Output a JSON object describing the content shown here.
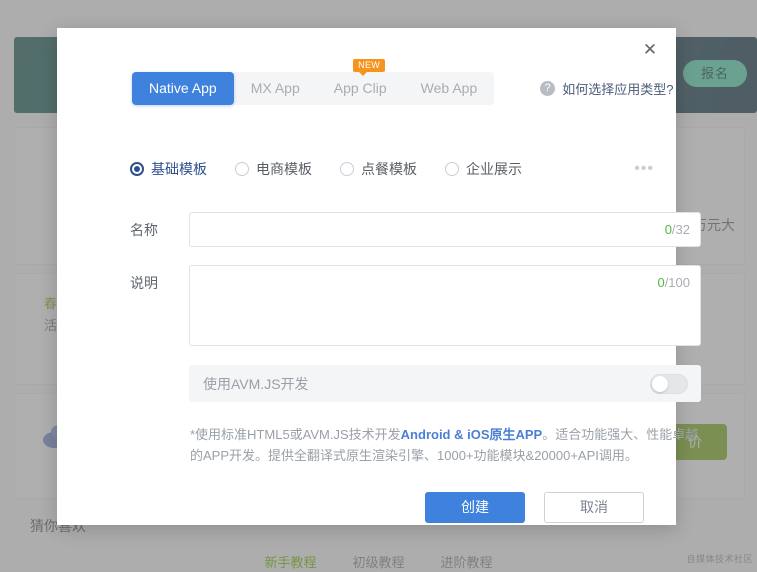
{
  "background": {
    "banner": {
      "pill_label": "报名"
    },
    "price_text": "万元大",
    "promo_line_1": "春",
    "promo_line_2": "活",
    "green_button_label": "价",
    "recommend_title": "猜你喜欢",
    "bottom_tabs": [
      {
        "label": "新手教程",
        "active": true
      },
      {
        "label": "初级教程",
        "active": false
      },
      {
        "label": "进阶教程",
        "active": false
      }
    ],
    "watermark": "自媒体技术社区"
  },
  "modal": {
    "close_label": "✕",
    "tabs": [
      {
        "label": "Native App",
        "active": true,
        "badge": null
      },
      {
        "label": "MX App",
        "active": false,
        "badge": null
      },
      {
        "label": "App Clip",
        "active": false,
        "badge": "NEW"
      },
      {
        "label": "Web App",
        "active": false,
        "badge": null
      }
    ],
    "help": {
      "icon_label": "?",
      "text": "如何选择应用类型?"
    },
    "templates": [
      {
        "label": "基础模板",
        "selected": true
      },
      {
        "label": "电商模板",
        "selected": false
      },
      {
        "label": "点餐模板",
        "selected": false
      },
      {
        "label": "企业展示",
        "selected": false
      }
    ],
    "more_label": "•••",
    "fields": {
      "name": {
        "label": "名称",
        "value": "",
        "placeholder": "",
        "counter_current": "0",
        "counter_max": "/32"
      },
      "description": {
        "label": "说明",
        "value": "",
        "placeholder": "",
        "counter_current": "0",
        "counter_max": "/100"
      }
    },
    "avm": {
      "label": "使用AVM.JS开发",
      "enabled": false
    },
    "footnote": {
      "prefix": "*使用标准HTML5或AVM.JS技术开发",
      "highlight": "Android & iOS原生APP",
      "suffix": "。适合功能强大、性能卓越的APP开发。提供全翻译式原生渲染引擎、1000+功能模块&20000+API调用。"
    },
    "buttons": {
      "create": "创建",
      "cancel": "取消"
    }
  },
  "colors": {
    "accent_blue": "#3e82de",
    "badge_orange": "#f7941e",
    "counter_green": "#52b544",
    "radio_selected": "#2d4f8e",
    "banner_pill_green": "#5ad9b4"
  }
}
